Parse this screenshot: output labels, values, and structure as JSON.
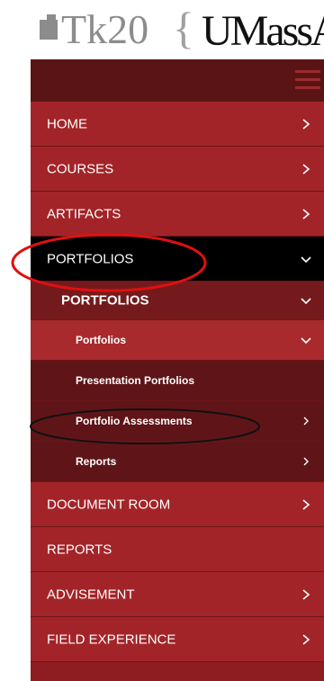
{
  "header": {
    "logo_app": "Tk20",
    "logo_brace": "{",
    "logo_institution": "UMassAm"
  },
  "nav": {
    "items": [
      {
        "label": "HOME",
        "level": 0,
        "chevron": "chevron-right-icon"
      },
      {
        "label": "COURSES",
        "level": 0,
        "chevron": "chevron-right-icon"
      },
      {
        "label": "ARTIFACTS",
        "level": 0,
        "chevron": "chevron-right-icon"
      },
      {
        "label": "PORTFOLIOS",
        "level": 0,
        "active": true,
        "chevron": "chevron-down-icon"
      },
      {
        "label": "PORTFOLIOS",
        "level": 1,
        "chevron": "chevron-down-icon"
      },
      {
        "label": "Portfolios",
        "level": 2,
        "chevron": "chevron-down-icon"
      },
      {
        "label": "Presentation Portfolios",
        "level": 2
      },
      {
        "label": "Portfolio Assessments",
        "level": 2,
        "chevron": "chevron-right-icon"
      },
      {
        "label": "Reports",
        "level": 2,
        "chevron": "chevron-right-icon"
      },
      {
        "label": "DOCUMENT ROOM",
        "level": 0,
        "chevron": "chevron-right-icon"
      },
      {
        "label": "REPORTS",
        "level": 0
      },
      {
        "label": "ADVISEMENT",
        "level": 0,
        "chevron": "chevron-right-icon"
      },
      {
        "label": "FIELD EXPERIENCE",
        "level": 0,
        "chevron": "chevron-right-icon"
      }
    ]
  },
  "colors": {
    "sidebar": "#a32428",
    "topbar": "#5a1416",
    "active": "#000000",
    "highlight_annotation": "#e01010",
    "secondary_annotation": "#111111"
  }
}
